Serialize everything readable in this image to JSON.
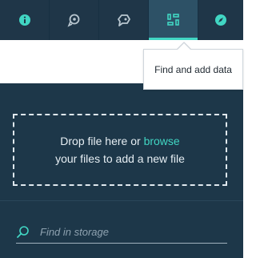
{
  "toolbar": {
    "buttons": [
      {
        "icon": "info-icon",
        "active": false
      },
      {
        "icon": "location-pin-icon",
        "active": false
      },
      {
        "icon": "tag-icon",
        "active": false
      },
      {
        "icon": "data-grid-icon",
        "active": true
      },
      {
        "icon": "compass-icon",
        "active": false
      }
    ]
  },
  "tooltip": {
    "text": "Find and add data"
  },
  "dropzone": {
    "text_before": "Drop file here or ",
    "browse_label": "browse",
    "text_after": "your files to add a new file"
  },
  "search": {
    "placeholder": "Find in storage",
    "value": ""
  },
  "colors": {
    "toolbar_bg": "#1f3648",
    "active_tab_bg": "#2d5166",
    "accent": "#41d6c3",
    "panel_bg": "#1d3749"
  }
}
